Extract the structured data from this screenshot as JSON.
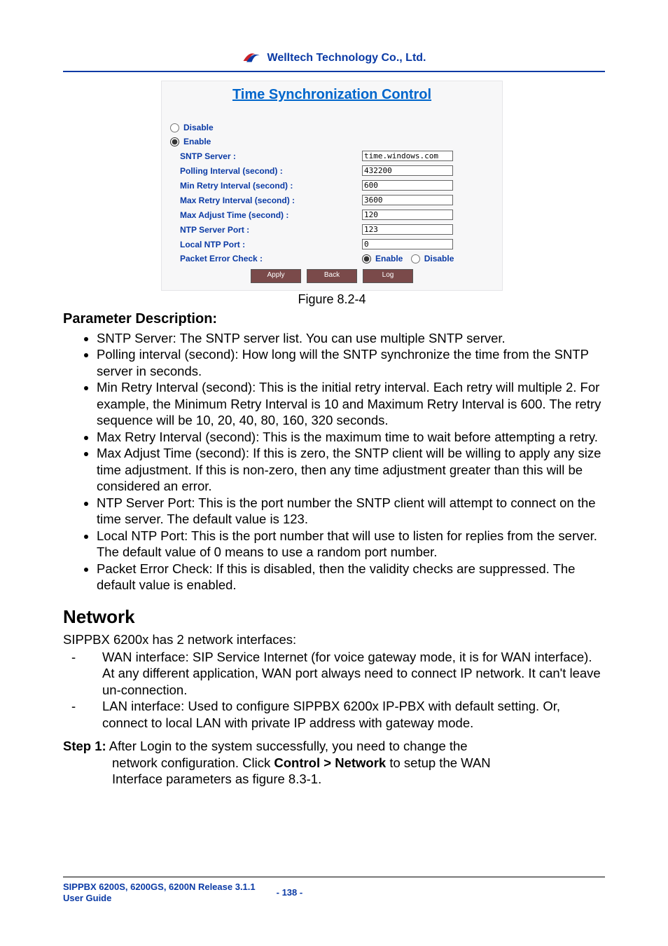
{
  "header": {
    "company": "Welltech Technology Co., Ltd."
  },
  "figure": {
    "title": "Time Synchronization Control",
    "radio_disable": "Disable",
    "radio_enable": "Enable",
    "fields": {
      "sntp_server_label": "SNTP Server :",
      "sntp_server_value": "time.windows.com",
      "polling_label": "Polling Interval (second) :",
      "polling_value": "432200",
      "min_retry_label": "Min Retry Interval (second) :",
      "min_retry_value": "600",
      "max_retry_label": "Max Retry Interval (second) :",
      "max_retry_value": "3600",
      "max_adjust_label": "Max Adjust Time (second) :",
      "max_adjust_value": "120",
      "ntp_port_label": "NTP Server Port :",
      "ntp_port_value": "123",
      "local_ntp_label": "Local NTP Port :",
      "local_ntp_value": "0",
      "pec_label": "Packet Error Check :",
      "pec_enable": "Enable",
      "pec_disable": "Disable"
    },
    "buttons": {
      "apply": "Apply",
      "back": "Back",
      "log": "Log"
    },
    "caption": "Figure 8.2-4"
  },
  "paramdesc_heading": "Parameter Description:",
  "bullets": [
    "SNTP Server: The SNTP server list. You can use multiple SNTP server.",
    "Polling interval (second): How long will the SNTP synchronize the time from the SNTP server in seconds.",
    "Min Retry Interval (second): This is the initial retry interval. Each retry will multiple 2. For example, the Minimum Retry Interval is 10 and Maximum Retry Interval is 600. The retry sequence will be 10, 20, 40, 80, 160, 320 seconds.",
    "Max Retry Interval (second): This is the maximum time to wait before attempting a retry.",
    "Max Adjust Time (second): If this is zero, the SNTP client will be willing to apply any size time adjustment. If this is non-zero, then any time adjustment greater than this will be considered an error.",
    "NTP Server Port: This is the port number the SNTP client will attempt to connect on the time server. The default value is 123.",
    "Local NTP Port: This is the port number that will use to listen for replies from the server. The default value of 0 means to use a random port number.",
    "Packet Error Check: If this is disabled, then the validity checks are suppressed. The default value is enabled."
  ],
  "network": {
    "heading": "Network",
    "intro": "SIPPBX 6200x has 2 network interfaces:",
    "items": [
      "WAN interface: SIP Service Internet (for voice gateway mode, it is for WAN interface). At any different application, WAN port always need to connect IP network. It can't leave un-connection.",
      "LAN interface: Used to configure SIPPBX 6200x IP-PBX with default setting. Or, connect to local LAN with private IP address with gateway mode."
    ],
    "step1_label": "Step 1:",
    "step1_line1": " After Login to the system successfully, you need to change the",
    "step1_line2a": "network configuration. Click ",
    "step1_bold": "Control > Network",
    "step1_line2b": " to setup the WAN",
    "step1_line3": "Interface parameters as figure 8.3-1."
  },
  "footer": {
    "doc": "SIPPBX 6200S, 6200GS, 6200N Release 3.1.1",
    "guide": "User Guide",
    "page": "- 138 -"
  }
}
